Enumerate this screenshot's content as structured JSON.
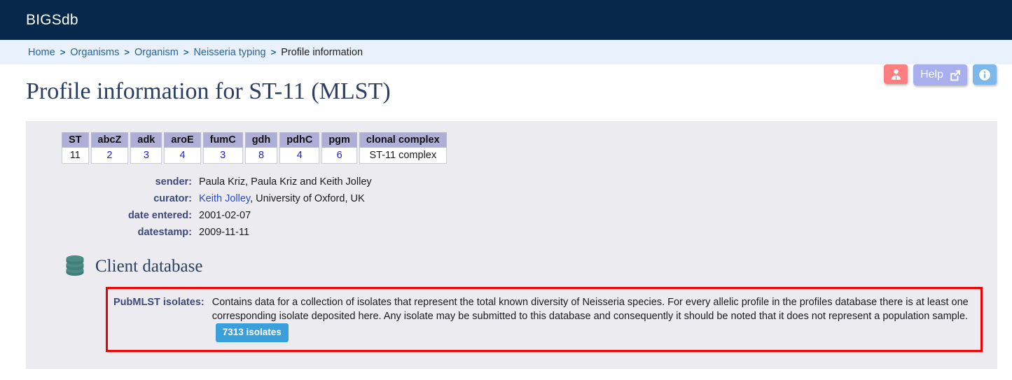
{
  "header": {
    "brand": "BIGSdb"
  },
  "breadcrumb": {
    "separator": ">",
    "items": [
      {
        "label": "Home",
        "link": true
      },
      {
        "label": "Organisms",
        "link": true
      },
      {
        "label": "Organism",
        "link": true
      },
      {
        "label": "Neisseria typing",
        "link": true
      },
      {
        "label": "Profile information",
        "link": false
      }
    ]
  },
  "actions": {
    "user_icon": "user-icon",
    "help_label": "Help",
    "help_icon": "external-link-icon",
    "info_icon": "info-icon",
    "colors": {
      "user_bg": "#ff7f80",
      "help_bg": "#a9aeed",
      "info_bg": "#7cb9ea"
    }
  },
  "page": {
    "title": "Profile information for ST-11 (MLST)"
  },
  "profile_table": {
    "headers": [
      "ST",
      "abcZ",
      "adk",
      "aroE",
      "fumC",
      "gdh",
      "pdhC",
      "pgm",
      "clonal complex"
    ],
    "values": [
      "11",
      "2",
      "3",
      "4",
      "3",
      "8",
      "4",
      "6",
      "ST-11 complex"
    ]
  },
  "meta": [
    {
      "label": "sender:",
      "value": "Paula Kriz, Paula Kriz and Keith Jolley"
    },
    {
      "label": "curator:",
      "link_text": "Keith Jolley",
      "value": ", University of Oxford, UK"
    },
    {
      "label": "date entered:",
      "value": "2001-02-07"
    },
    {
      "label": "datestamp:",
      "value": "2009-11-11"
    }
  ],
  "client_database": {
    "section_icon": "database-icon",
    "section_title": "Client database",
    "entry_label": "PubMLST isolates:",
    "description": "Contains data for a collection of isolates that represent the total known diversity of Neisseria species. For every allelic profile in the profiles database there is at least one corresponding isolate deposited here. Any isolate may be submitted to this database and consequently it should be noted that it does not represent a population sample.",
    "isolate_badge": "7313 isolates",
    "highlight_color": "#f00000",
    "badge_color": "#3aa0dc",
    "icon_color": "#3f7f7b"
  }
}
